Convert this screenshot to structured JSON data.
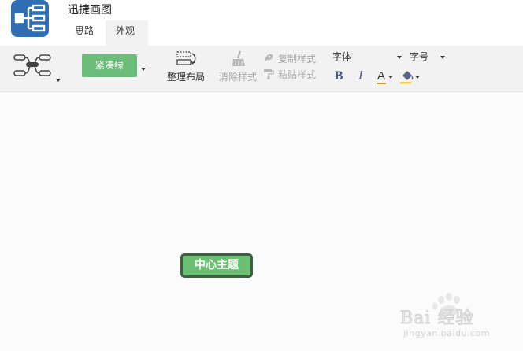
{
  "app": {
    "title": "迅捷画图",
    "brand_color": "#2f6db5",
    "icon": "mindmap-app-icon"
  },
  "tabs": [
    {
      "label": "思路",
      "active": false
    },
    {
      "label": "外观",
      "active": true
    }
  ],
  "toolbar": {
    "structure_icon": "mindmap-structure-icon",
    "theme": {
      "label": "紧凑绿",
      "color": "#6dbd7a"
    },
    "tidy_layout_label": "整理布局",
    "clear_style_label": "清除样式",
    "copy_style_label": "复制样式",
    "paste_style_label": "粘贴样式",
    "font": {
      "placeholder": "字体"
    },
    "font_size": {
      "placeholder": "字号"
    },
    "bold_label": "B",
    "italic_label": "I",
    "font_color_label": "A",
    "font_color_value": "#d79a1a",
    "fill_color_icon": "paint-bucket-icon"
  },
  "canvas": {
    "central_topic": {
      "label": "中心主题",
      "fill": "#6cbf73",
      "border": "#3f5f44"
    }
  },
  "watermark": {
    "text": "Bai 经验",
    "subtext": "jingyan.baidu.com"
  }
}
